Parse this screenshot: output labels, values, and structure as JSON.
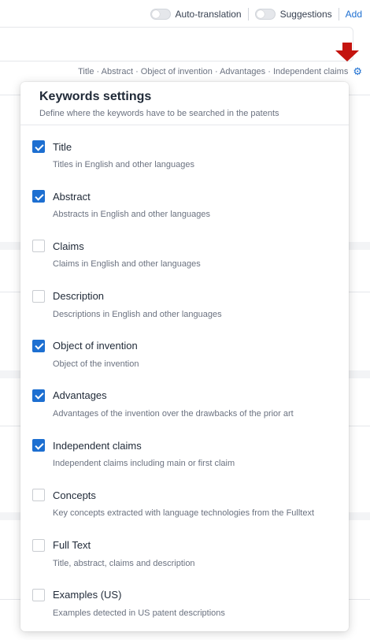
{
  "topbar": {
    "auto_translation_label": "Auto-translation",
    "suggestions_label": "Suggestions",
    "add_label": "Add"
  },
  "fields_summary": "Title · Abstract · Object of invention · Advantages · Independent claims",
  "icons": {
    "settings": "⚙"
  },
  "colors": {
    "accent": "#1d6fd1",
    "arrow": "#c4140f"
  },
  "keywords_settings": {
    "title": "Keywords settings",
    "subtitle": "Define where the keywords have to be searched in the patents",
    "options": [
      {
        "label": "Title",
        "description": "Titles in English and other languages",
        "checked": true
      },
      {
        "label": "Abstract",
        "description": "Abstracts in English and other languages",
        "checked": true
      },
      {
        "label": "Claims",
        "description": "Claims in English and other languages",
        "checked": false
      },
      {
        "label": "Description",
        "description": "Descriptions in English and other languages",
        "checked": false
      },
      {
        "label": "Object of invention",
        "description": "Object of the invention",
        "checked": true
      },
      {
        "label": "Advantages",
        "description": "Advantages of the invention over the drawbacks of the prior art",
        "checked": true
      },
      {
        "label": "Independent claims",
        "description": "Independent claims including main or first claim",
        "checked": true
      },
      {
        "label": "Concepts",
        "description": "Key concepts extracted with language technologies from the Fulltext",
        "checked": false
      },
      {
        "label": "Full Text",
        "description": "Title, abstract, claims and description",
        "checked": false
      },
      {
        "label": "Examples (US)",
        "description": "Examples detected in US patent descriptions",
        "checked": false
      }
    ]
  }
}
